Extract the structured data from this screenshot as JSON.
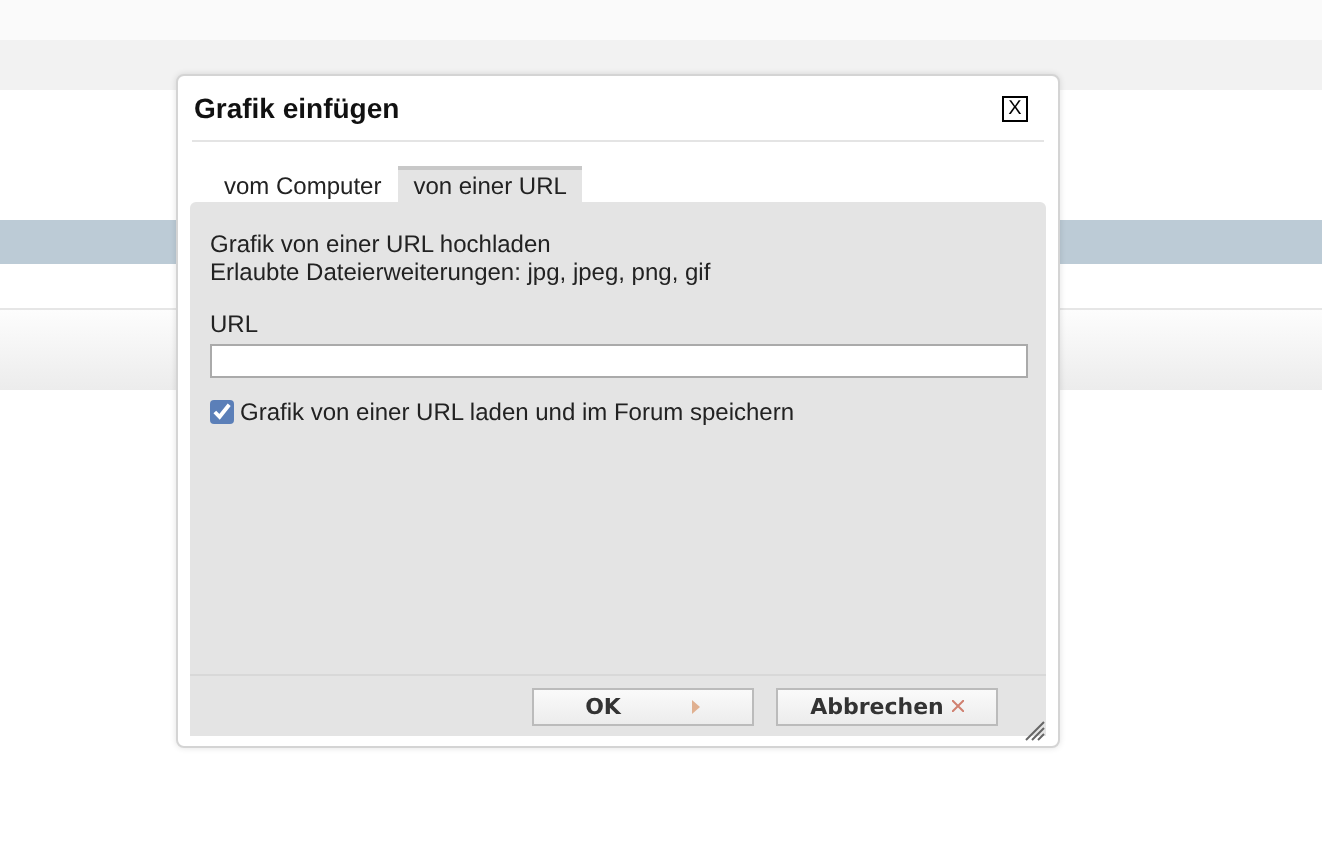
{
  "dialog": {
    "title": "Grafik einfügen",
    "close": "X"
  },
  "tabs": [
    {
      "label": "vom Computer",
      "selected": false
    },
    {
      "label": "von einer URL",
      "selected": true
    }
  ],
  "intro": [
    "Grafik von einer URL hochladen",
    "Erlaubte Dateierweiterungen: jpg, jpeg, png, gif"
  ],
  "url_field": {
    "label": "URL"
  },
  "store_option": {
    "label": "Grafik von einer URL laden und im Forum speichern",
    "checked": true
  },
  "buttons": [
    {
      "label": "OK",
      "kind": "ok"
    },
    {
      "label": "Abbrechen",
      "kind": "cancel"
    }
  ]
}
